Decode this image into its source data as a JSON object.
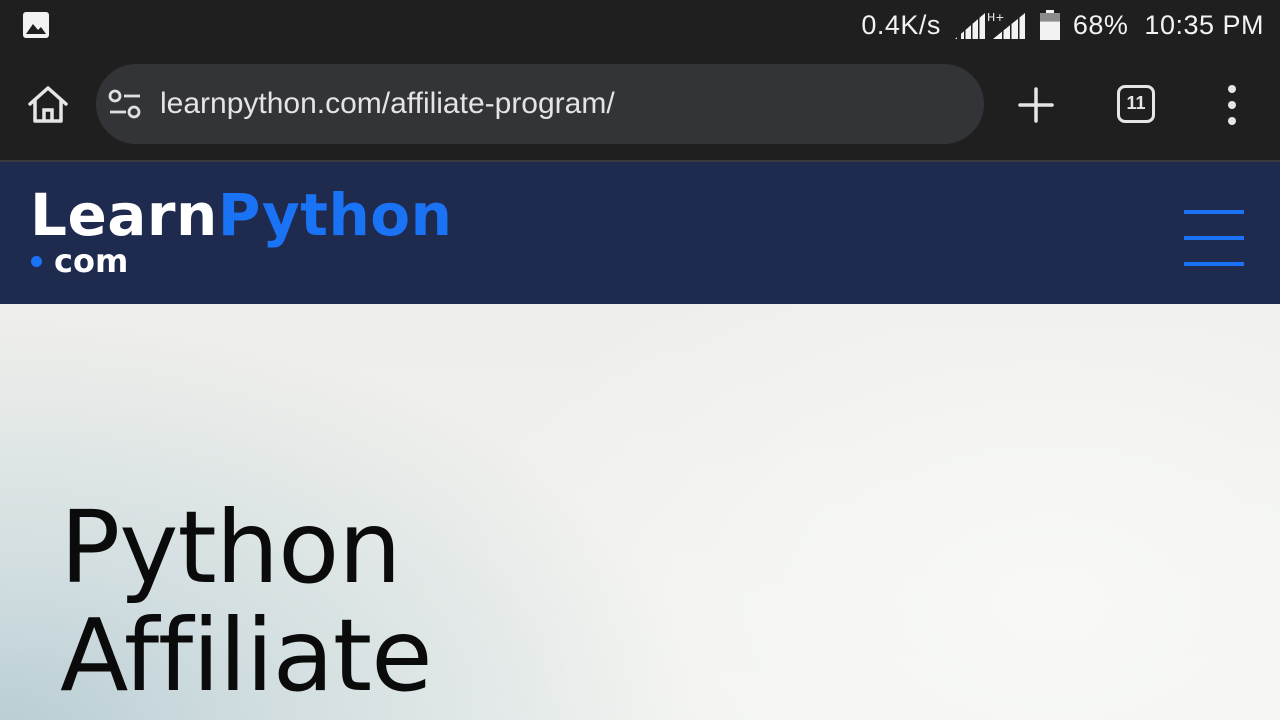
{
  "status_bar": {
    "network_speed": "0.4K/s",
    "network_type": "H+",
    "battery_percent": "68%",
    "battery_level": 0.68,
    "time": "10:35 PM",
    "icons": [
      "gallery-icon",
      "signal-icon",
      "battery-icon"
    ]
  },
  "browser": {
    "url": "learnpython.com/affiliate-program/",
    "tab_count": "11",
    "icons": [
      "home-icon",
      "site-settings-icon",
      "new-tab-plus-icon",
      "tabs-icon",
      "more-menu-icon"
    ]
  },
  "site": {
    "logo_learn": "Learn",
    "logo_python": "Python",
    "logo_com": "com",
    "brand_color": "#1a73f5",
    "header_bg": "#1f2a4f",
    "menu_icon": "hamburger-icon"
  },
  "hero": {
    "title_line1": "Python",
    "title_line2": "Affiliate"
  }
}
